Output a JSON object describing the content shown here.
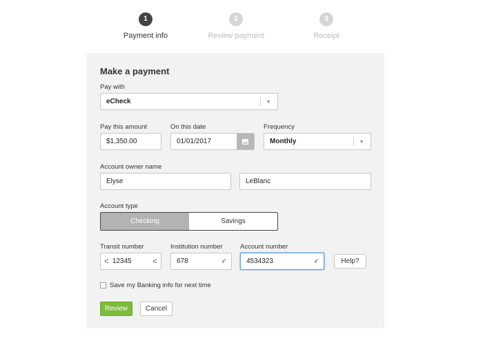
{
  "stepper": [
    {
      "number": "1",
      "label": "Payment info",
      "state": "active"
    },
    {
      "number": "2",
      "label": "Review payment",
      "state": "inactive"
    },
    {
      "number": "3",
      "label": "Receipt",
      "state": "inactive"
    }
  ],
  "form": {
    "title": "Make a payment",
    "pay_with": {
      "label": "Pay with",
      "value": "eCheck"
    },
    "amount": {
      "label": "Pay this amount",
      "value": "$1,350.00"
    },
    "date": {
      "label": "On this date",
      "value": "01/01/2017"
    },
    "frequency": {
      "label": "Frequency",
      "value": "Monthly"
    },
    "owner": {
      "label": "Account owner name",
      "first": "Elyse",
      "last": "LeBlanc"
    },
    "account_type": {
      "label": "Account type",
      "options": [
        "Checking",
        "Savings"
      ],
      "selected": "Checking"
    },
    "transit": {
      "label": "Transit number",
      "value": "12345"
    },
    "institution": {
      "label": "Institution number",
      "value": "678"
    },
    "account": {
      "label": "Account number",
      "value": "4534323"
    },
    "help_label": "Help?",
    "save_label": "Save my Banking info for next time",
    "save_checked": false,
    "review_label": "Review",
    "cancel_label": "Cancel"
  },
  "colors": {
    "accent_green": "#7dbb3b",
    "active_step": "#444444",
    "inactive_step": "#d6d6d6",
    "panel_bg": "#f2f2f2",
    "focus_border": "#6fa1d6"
  },
  "icons": {
    "caret": "chevron-down-icon",
    "calendar": "calendar-icon",
    "transit": "routing-icon",
    "institution": "check-digits-icon",
    "account": "check-digits-icon"
  }
}
